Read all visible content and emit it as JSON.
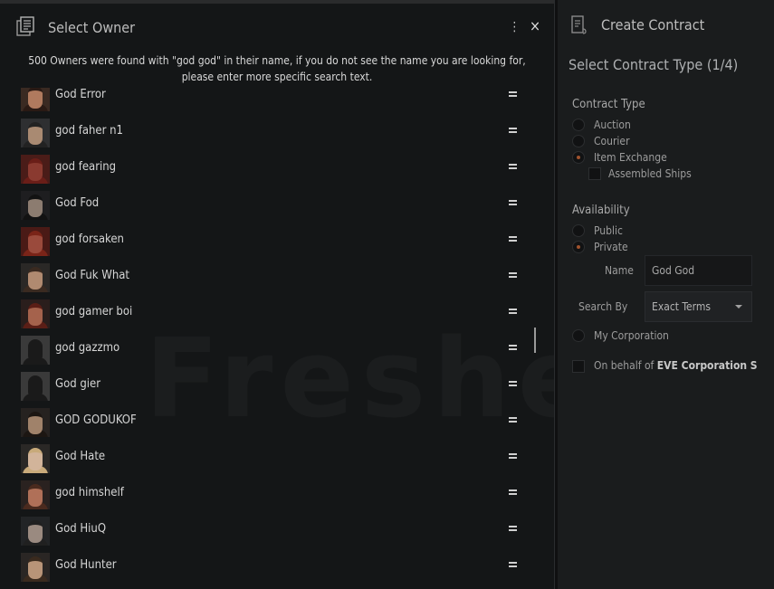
{
  "owner_window": {
    "title": "Select Owner",
    "menu_icon": "⋮",
    "close_icon": "×",
    "message": "500 Owners were found with \"god god\" in their name, if you do not see the name you are looking for, please enter more specific search text.",
    "owners": [
      {
        "name": "God Error",
        "portrait": {
          "bg": "#3a2a22",
          "skin": "#b07a5e",
          "hair": "#2a1a14"
        }
      },
      {
        "name": "god faher n1",
        "portrait": {
          "bg": "#2e2f31",
          "skin": "#a98a72",
          "hair": "#222222"
        }
      },
      {
        "name": "god fearing",
        "portrait": {
          "bg": "#4a1c18",
          "skin": "#8a3a30",
          "hair": "#6a1e18"
        }
      },
      {
        "name": "God Fod",
        "portrait": {
          "bg": "#1e1e20",
          "skin": "#8c7c70",
          "hair": "#121212"
        }
      },
      {
        "name": "god forsaken",
        "portrait": {
          "bg": "#4a1a16",
          "skin": "#9a4a3c",
          "hair": "#7a2418"
        }
      },
      {
        "name": "God Fuk What",
        "portrait": {
          "bg": "#2a2826",
          "skin": "#b08a70",
          "hair": "#3a2a20"
        }
      },
      {
        "name": "god gamer boi",
        "portrait": {
          "bg": "#2a1e1c",
          "skin": "#a5624c",
          "hair": "#5a1e16"
        }
      },
      {
        "name": "god gazzmo",
        "portrait": {
          "bg": "#3a3a3a",
          "skin": "#1a1a1a",
          "hair": "#1a1a1a"
        }
      },
      {
        "name": "God gier",
        "portrait": {
          "bg": "#3a3a3a",
          "skin": "#1a1a1a",
          "hair": "#1a1a1a"
        }
      },
      {
        "name": "GOD GODUKOF",
        "portrait": {
          "bg": "#262220",
          "skin": "#a0826a",
          "hair": "#1c1612"
        }
      },
      {
        "name": "God Hate",
        "portrait": {
          "bg": "#2a2826",
          "skin": "#d2b49a",
          "hair": "#c8aa7a"
        }
      },
      {
        "name": "god himshelf",
        "portrait": {
          "bg": "#2a2220",
          "skin": "#b07058",
          "hair": "#4a2a1e"
        }
      },
      {
        "name": "God HiuQ",
        "portrait": {
          "bg": "#222426",
          "skin": "#9a8a80",
          "hair": "#202020"
        }
      },
      {
        "name": "God Hunter",
        "portrait": {
          "bg": "#2a2624",
          "skin": "#b89478",
          "hair": "#3a2a1e"
        }
      }
    ]
  },
  "contract_window": {
    "title": "Create Contract",
    "step_title": "Select Contract Type (1/4)",
    "contract_type_label": "Contract Type",
    "contract_types": [
      {
        "label": "Auction",
        "selected": false
      },
      {
        "label": "Courier",
        "selected": false
      },
      {
        "label": "Item Exchange",
        "selected": true
      }
    ],
    "assembled_ships_label": "Assembled Ships",
    "availability_label": "Availability",
    "availability": [
      {
        "label": "Public",
        "selected": false
      },
      {
        "label": "Private",
        "selected": true
      }
    ],
    "name_label": "Name",
    "name_value": "God God",
    "search_by_label": "Search By",
    "search_by_value": "Exact Terms",
    "my_corporation_label": "My Corporation",
    "on_behalf_prefix": "On behalf of",
    "on_behalf_corp": "EVE Corporation S"
  },
  "background_watermark": "Freshe",
  "colors": {
    "accent_radio": "#a0522d",
    "panel": "#141617",
    "side_panel": "#1a1c1d"
  }
}
